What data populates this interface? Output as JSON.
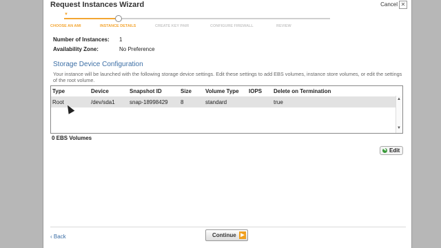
{
  "window": {
    "title": "Request Instances Wizard",
    "cancel_label": "Cancel",
    "close_glyph": "✕"
  },
  "steps": [
    {
      "label": "CHOOSE AN AMI",
      "state": "done"
    },
    {
      "label": "INSTANCE DETAILS",
      "state": "current"
    },
    {
      "label": "CREATE KEY PAIR",
      "state": "pending"
    },
    {
      "label": "CONFIGURE FIREWALL",
      "state": "pending"
    },
    {
      "label": "REVIEW",
      "state": "pending"
    }
  ],
  "details": {
    "instances_label": "Number of Instances:",
    "instances_value": "1",
    "zone_label": "Availability Zone:",
    "zone_value": "No Preference"
  },
  "storage": {
    "title": "Storage Device Configuration",
    "description": "Your instance will be launched with the following storage device settings. Edit these settings to add EBS volumes, instance store volumes, or edit the settings of the root volume.",
    "columns": [
      "Type",
      "Device",
      "Snapshot ID",
      "Size",
      "Volume Type",
      "IOPS",
      "Delete on Termination"
    ],
    "rows": [
      [
        "Root",
        "/dev/sda1",
        "snap-18998429",
        "8",
        "standard",
        "",
        "true"
      ]
    ],
    "ebs_count": "0 EBS Volumes",
    "edit_label": "Edit"
  },
  "footer": {
    "back_label": "‹ Back",
    "continue_label": "Continue"
  },
  "colors": {
    "accent": "#f3a531",
    "link": "#3b6ea5"
  }
}
